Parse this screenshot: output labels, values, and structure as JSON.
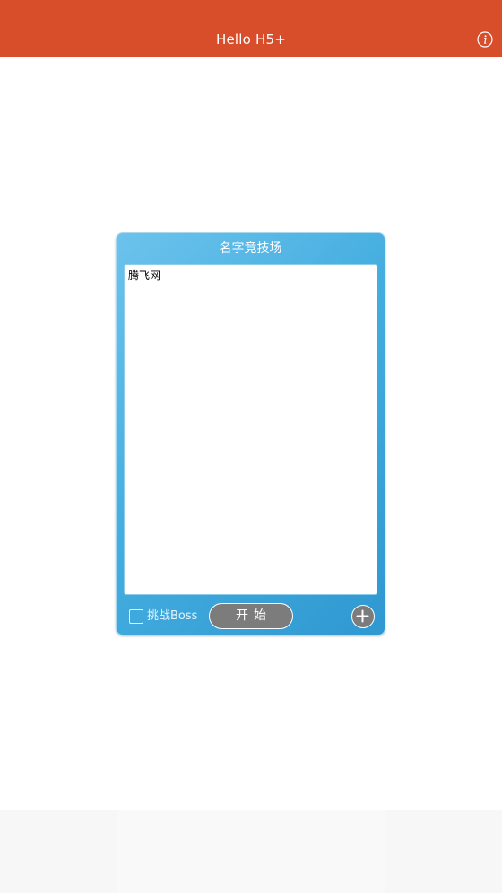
{
  "header": {
    "title": "Hello H5+",
    "info_icon": "info-icon"
  },
  "card": {
    "title": "名字竞技场",
    "names_text": "腾飞网",
    "boss_checkbox": {
      "label": "挑战Boss",
      "checked": false
    },
    "start_label": "开始",
    "add_icon": "plus-circle-icon"
  },
  "colors": {
    "header_bg": "#d84d2a",
    "card_accent": "#45aee0",
    "button_bg": "#7c7c7c"
  }
}
